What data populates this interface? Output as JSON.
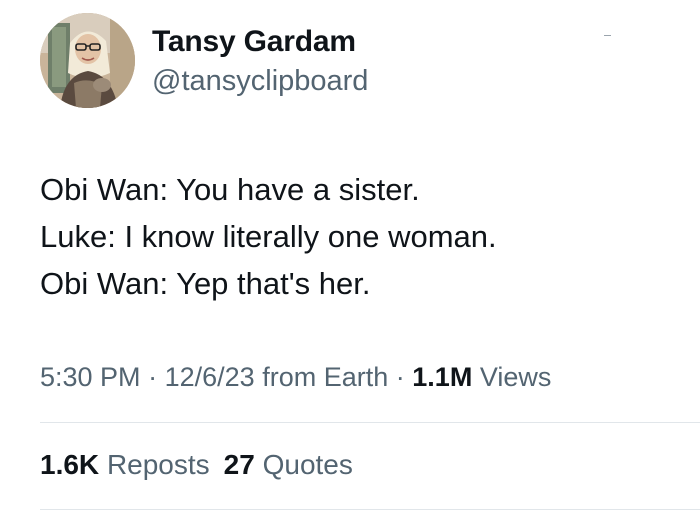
{
  "author": {
    "display_name": "Tansy Gardam",
    "handle": "@tansyclipboard"
  },
  "tweet": {
    "lines": [
      "Obi Wan: You have a sister.",
      "Luke: I know literally one woman.",
      "Obi Wan: Yep that's her."
    ]
  },
  "meta": {
    "time": "5:30 PM",
    "separator": "·",
    "date": "12/6/23",
    "source": "from Earth",
    "views_count": "1.1M",
    "views_label": "Views"
  },
  "stats": {
    "reposts_count": "1.6K",
    "reposts_label": "Reposts",
    "quotes_count": "27",
    "quotes_label": "Quotes"
  },
  "colors": {
    "text_primary": "#0f1419",
    "text_secondary": "#536471",
    "divider": "#e1e6ea",
    "background": "#ffffff"
  }
}
